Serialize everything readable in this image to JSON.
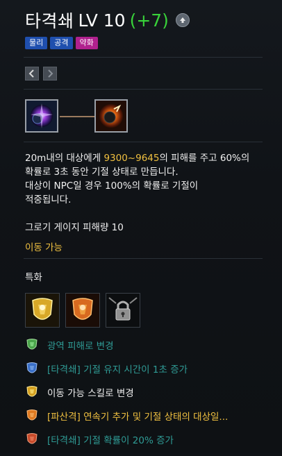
{
  "skill": {
    "name": "타격쇄",
    "level": "LV 10",
    "bonus": "(+7)"
  },
  "tags": [
    {
      "label": "물리",
      "color": "#1f4fae"
    },
    {
      "label": "공격",
      "color": "#1f4fae"
    },
    {
      "label": "약화",
      "color": "#b0218e"
    }
  ],
  "description": {
    "line1_prefix": "20m내의 대상에게 ",
    "line1_value": "9300~9645",
    "line1_suffix": "의 피해를 주고 60%의",
    "line2": "확률로 3초 동안 기절 상태로 만듭니다.",
    "line3": "대상이 NPC일 경우 100%의 확률로 기절이",
    "line4": "적중됩니다."
  },
  "gauge_text": "그로기 게이지 피해량 10",
  "movable_text": "이동 가능",
  "tripod_title": "특화",
  "tripods": [
    {
      "label": "광역 피해로 변경",
      "style": "dim",
      "icon_color": "#4aa34a"
    },
    {
      "label": "[타격쇄] 기절 유지 시간이 1초 증가",
      "style": "dim",
      "icon_color": "#3a6fc8"
    },
    {
      "label": "이동 가능 스킬로 변경",
      "style": "bright",
      "icon_color": "#d4a020"
    },
    {
      "label": "[파산격] 연속기 추가 및 기절 상태의 대상일...",
      "style": "yellow",
      "icon_color": "#e07a20"
    },
    {
      "label": "[타격쇄] 기절 확률이 20% 증가",
      "style": "dim",
      "icon_color": "#c84a2a"
    }
  ]
}
